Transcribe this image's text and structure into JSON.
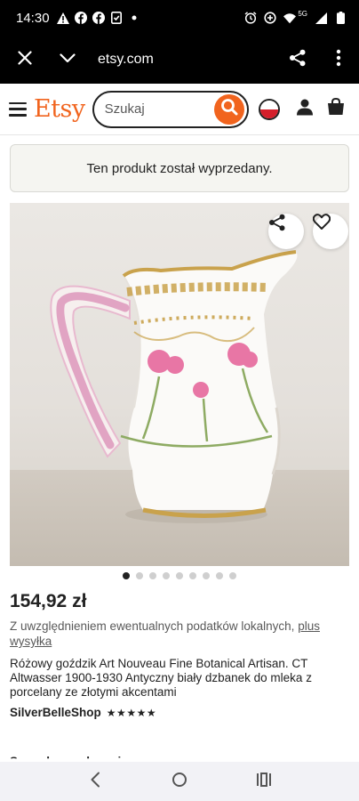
{
  "status_bar": {
    "time": "14:30",
    "icons_left": [
      "warning-icon",
      "facebook-icon",
      "facebook-icon",
      "save-notification-icon",
      "dot-icon"
    ],
    "icons_right": [
      "alarm-icon",
      "data-saver-icon",
      "wifi-icon",
      "signal-icon",
      "battery-icon"
    ],
    "network_label": "5G"
  },
  "browser": {
    "url": "etsy.com",
    "close_icon": "close-icon",
    "expand_icon": "chevron-down-icon",
    "share_icon": "share-icon",
    "menu_icon": "more-vert-icon"
  },
  "header": {
    "logo": "Etsy",
    "search_placeholder": "Szukaj",
    "accent_color": "#f1641e"
  },
  "banner": {
    "text": "Ten produkt został wyprzedany."
  },
  "photo": {
    "dot_count": 9,
    "active_dot": 0
  },
  "product": {
    "price": "154,92 zł",
    "tax_note": "Z uwzględnieniem ewentualnych podatków lokalnych,",
    "shipping_link": "plus wysyłka",
    "title": "Różowy goździk Art Nouveau Fine Botanical Artisan. CT Altwasser 1900-1930 Antyczny biały dzbanek do mleka z porcelany ze złotymi akcentami",
    "shop_name": "SilverBelleShop",
    "rating_stars": "★★★★★",
    "rating": 5
  },
  "truncated_text": "Sprzedawca doceniony"
}
